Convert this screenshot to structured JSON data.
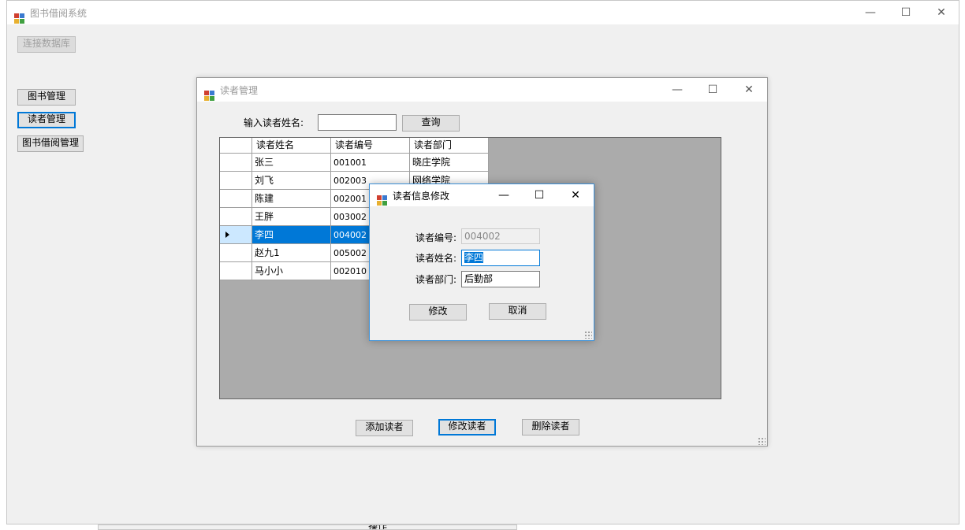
{
  "main": {
    "title": "图书借阅系统",
    "connect_button": "连接数据库",
    "nav": [
      "图书管理",
      "读者管理",
      "图书借阅管理"
    ],
    "bottom_fragment": "操作"
  },
  "reader_window": {
    "title": "读者管理",
    "search_label": "输入读者姓名:",
    "search_value": "",
    "search_button": "查询",
    "columns": [
      "读者姓名",
      "读者编号",
      "读者部门"
    ],
    "rows": [
      [
        "张三",
        "001001",
        "晓庄学院"
      ],
      [
        "刘飞",
        "002003",
        "网络学院"
      ],
      [
        "陈建",
        "002001",
        ""
      ],
      [
        "王胖",
        "003002",
        ""
      ],
      [
        "李四",
        "004002",
        ""
      ],
      [
        "赵九1",
        "005002",
        ""
      ],
      [
        "马小小",
        "002010",
        ""
      ]
    ],
    "selected_row": 4,
    "add_button": "添加读者",
    "edit_button": "修改读者",
    "delete_button": "删除读者"
  },
  "edit_dialog": {
    "title": "读者信息修改",
    "id_label": "读者编号:",
    "id_value": "004002",
    "name_label": "读者姓名:",
    "name_value": "李四",
    "dept_label": "读者部门:",
    "dept_value": "后勤部",
    "confirm_button": "修改",
    "cancel_button": "取消"
  },
  "colors": {
    "selection": "#0078d7",
    "focus_border": "#0078d7",
    "window_bg": "#f0f0f0",
    "grid_bg": "#ababab"
  }
}
